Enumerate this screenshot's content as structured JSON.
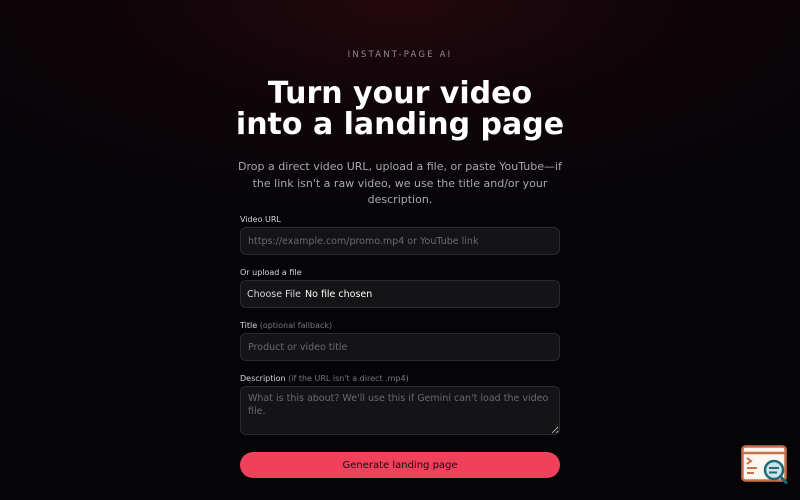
{
  "header": {
    "eyebrow": "INSTANT-PAGE AI",
    "title_line1": "Turn your video",
    "title_line2": "into a landing page",
    "subtitle": "Drop a direct video URL, upload a file, or paste YouTube—if the link isn't a raw video, we use the title and/or your description."
  },
  "form": {
    "video_url": {
      "label": "Video URL",
      "placeholder": "https://example.com/promo.mp4 or YouTube link",
      "value": ""
    },
    "upload": {
      "label": "Or upload a file",
      "button_label": "Choose File",
      "status": "No file chosen"
    },
    "title": {
      "label": "Title",
      "hint": "(optional fallback)",
      "placeholder": "Product or video title",
      "value": ""
    },
    "description": {
      "label": "Description",
      "hint": "(if the URL isn't a direct .mp4)",
      "placeholder": "What is this about? We'll use this if Gemini can't load the video file.",
      "value": ""
    },
    "submit_label": "Generate landing page"
  },
  "widget": {
    "icon": "terminal-search-icon",
    "colors": {
      "frame": "#c8704a",
      "lens": "#1d6b78"
    }
  }
}
